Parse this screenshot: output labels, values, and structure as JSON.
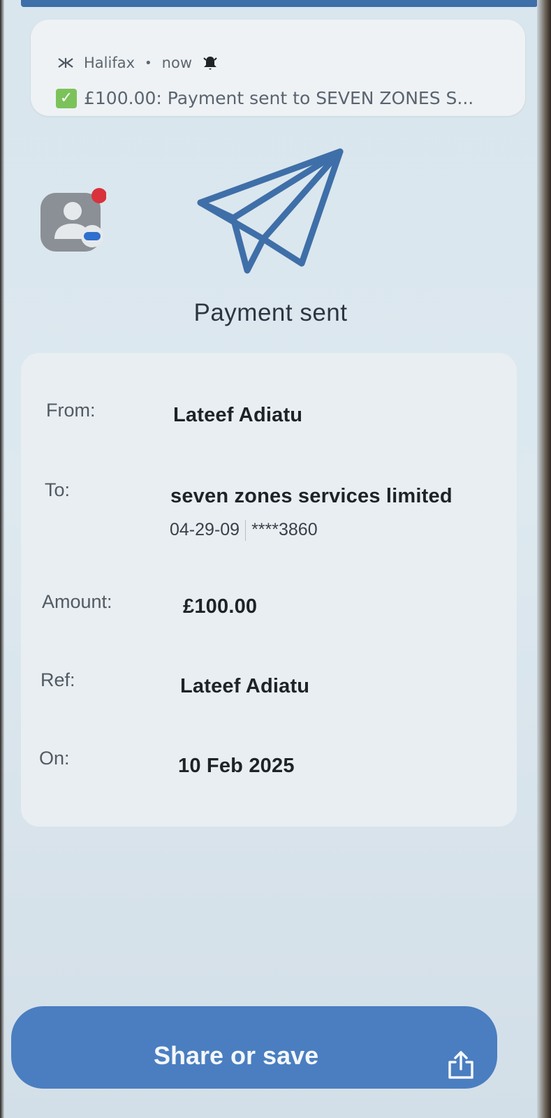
{
  "notification": {
    "app_name": "Halifax",
    "separator": "•",
    "time": "now",
    "message": "£100.00: Payment sent to SEVEN ZONES S..."
  },
  "page": {
    "title": "Payment sent"
  },
  "details": {
    "from_label": "From:",
    "from_value": "Lateef Adiatu",
    "to_label": "To:",
    "to_name": "seven zones services limited",
    "to_sort_code": "04-29-09",
    "to_account": "****3860",
    "amount_label": "Amount:",
    "amount_value": "£100.00",
    "ref_label": "Ref:",
    "ref_value": "Lateef Adiatu",
    "on_label": "On:",
    "on_value": "10 Feb 2025"
  },
  "actions": {
    "share_label": "Share or save"
  },
  "icons": {
    "notification_app": "halifax-logo-icon",
    "alarm": "bell-icon",
    "check": "checkbox-check-icon",
    "badge": "contact-chat-icon",
    "hero": "paper-plane-icon",
    "share": "share-icon"
  },
  "colors": {
    "accent": "#4a7ec0",
    "plane_stroke": "#3f6fa8",
    "check": "#7cc25a",
    "badge_red": "#d8323c",
    "badge_blue": "#2f6fce"
  }
}
